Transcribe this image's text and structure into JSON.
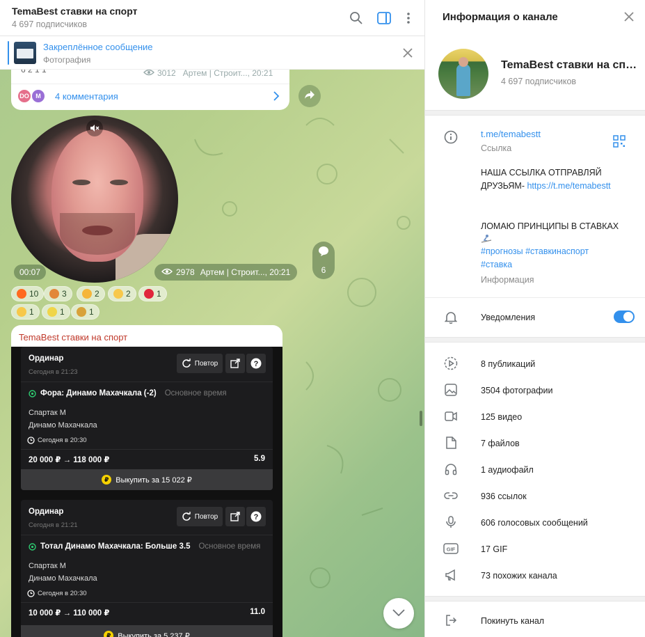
{
  "chat": {
    "title": "TemaBest ставки на спорт",
    "subscribers": "4 697 подписчиков",
    "pinned": {
      "title": "Закреплённое сообщение",
      "subtitle": "Фотография"
    },
    "post1": {
      "reactions_cut": "6   2   1   1",
      "views": "3012",
      "signature": "Артем | Строит..., 20:21",
      "comments": "4 комментария",
      "avatars": [
        {
          "initials": "DO",
          "color": "#e56f8b"
        },
        {
          "initials": "M",
          "color": "#9a6fd6"
        }
      ]
    },
    "post2": {
      "duration": "00:07",
      "views": "2978",
      "signature": "Артем | Строит..., 20:21",
      "comments_count": "6",
      "reactions": [
        {
          "emoji": "fire",
          "color": "#ff6a1f",
          "count": "10"
        },
        {
          "emoji": "hotdog",
          "color": "#e2873a",
          "count": "3"
        },
        {
          "emoji": "thumbs-up",
          "color": "#f5b53a",
          "count": "2"
        },
        {
          "emoji": "grin",
          "color": "#f7c84a",
          "count": "2"
        },
        {
          "emoji": "heart",
          "color": "#e0263a",
          "count": "1"
        },
        {
          "emoji": "laughing",
          "color": "#f7c84a",
          "count": "1"
        },
        {
          "emoji": "banana",
          "color": "#f0d54a",
          "count": "1"
        },
        {
          "emoji": "trophy",
          "color": "#d8a23a",
          "count": "1"
        }
      ]
    },
    "post3": {
      "author": "TemaBest ставки на спорт",
      "cards": [
        {
          "type": "Ординар",
          "time": "Сегодня в 21:23",
          "repeat": "Повтор",
          "bet": "Фора: Динамо Махачкала (-2)",
          "bet_sub": "Основное время",
          "team1": "Спартак М",
          "team2": "Динамо Махачкала",
          "match_time": "Сегодня в 20:30",
          "amount": "20 000 ₽  →  118 000 ₽",
          "coef": "5.9",
          "buyout": "Выкупить за 15 022 ₽"
        },
        {
          "type": "Ординар",
          "time": "Сегодня в 21:21",
          "repeat": "Повтор",
          "bet": "Тотал Динамо Махачкала: Больше 3.5",
          "bet_sub": "Основное время",
          "team1": "Спартак М",
          "team2": "Динамо Махачкала",
          "match_time": "Сегодня в 20:30",
          "amount": "10 000 ₽  →  110 000 ₽",
          "coef": "11.0",
          "buyout": "Выкупить за 5 237 ₽"
        }
      ]
    }
  },
  "panel": {
    "title": "Информация о канале",
    "name": "TemaBest ставки на спорт",
    "subscribers": "4 697 подписчиков",
    "link": "t.me/temabestt",
    "link_label": "Ссылка",
    "desc_line1": "НАША ССЫЛКА  ОТПРАВЛЯЙ",
    "desc_line2_text": "ДРУЗЬЯМ-  ",
    "desc_line2_link": "https://t.me/temabestt",
    "desc_line3": "ЛОМАЮ ПРИНЦИПЫ В СТАВКАХ",
    "hashtags1": "#прогнозы #ставкинаспорт",
    "hashtags2": "#ставка",
    "info_label": "Информация",
    "notifications": "Уведомления",
    "media": [
      {
        "icon": "publications-icon",
        "label": "8 публикаций"
      },
      {
        "icon": "photo-icon",
        "label": "3504 фотографии"
      },
      {
        "icon": "video-icon",
        "label": "125 видео"
      },
      {
        "icon": "file-icon",
        "label": "7 файлов"
      },
      {
        "icon": "headphones-icon",
        "label": "1 аудиофайл"
      },
      {
        "icon": "link-icon",
        "label": "936 ссылок"
      },
      {
        "icon": "microphone-icon",
        "label": "606 голосовых сообщений"
      },
      {
        "icon": "gif-icon",
        "label": "17 GIF"
      },
      {
        "icon": "megaphone-icon",
        "label": "73 похожих канала"
      }
    ],
    "leave": "Покинуть канал"
  },
  "colors": {
    "accent": "#3390ec",
    "author": "#c0392b"
  }
}
